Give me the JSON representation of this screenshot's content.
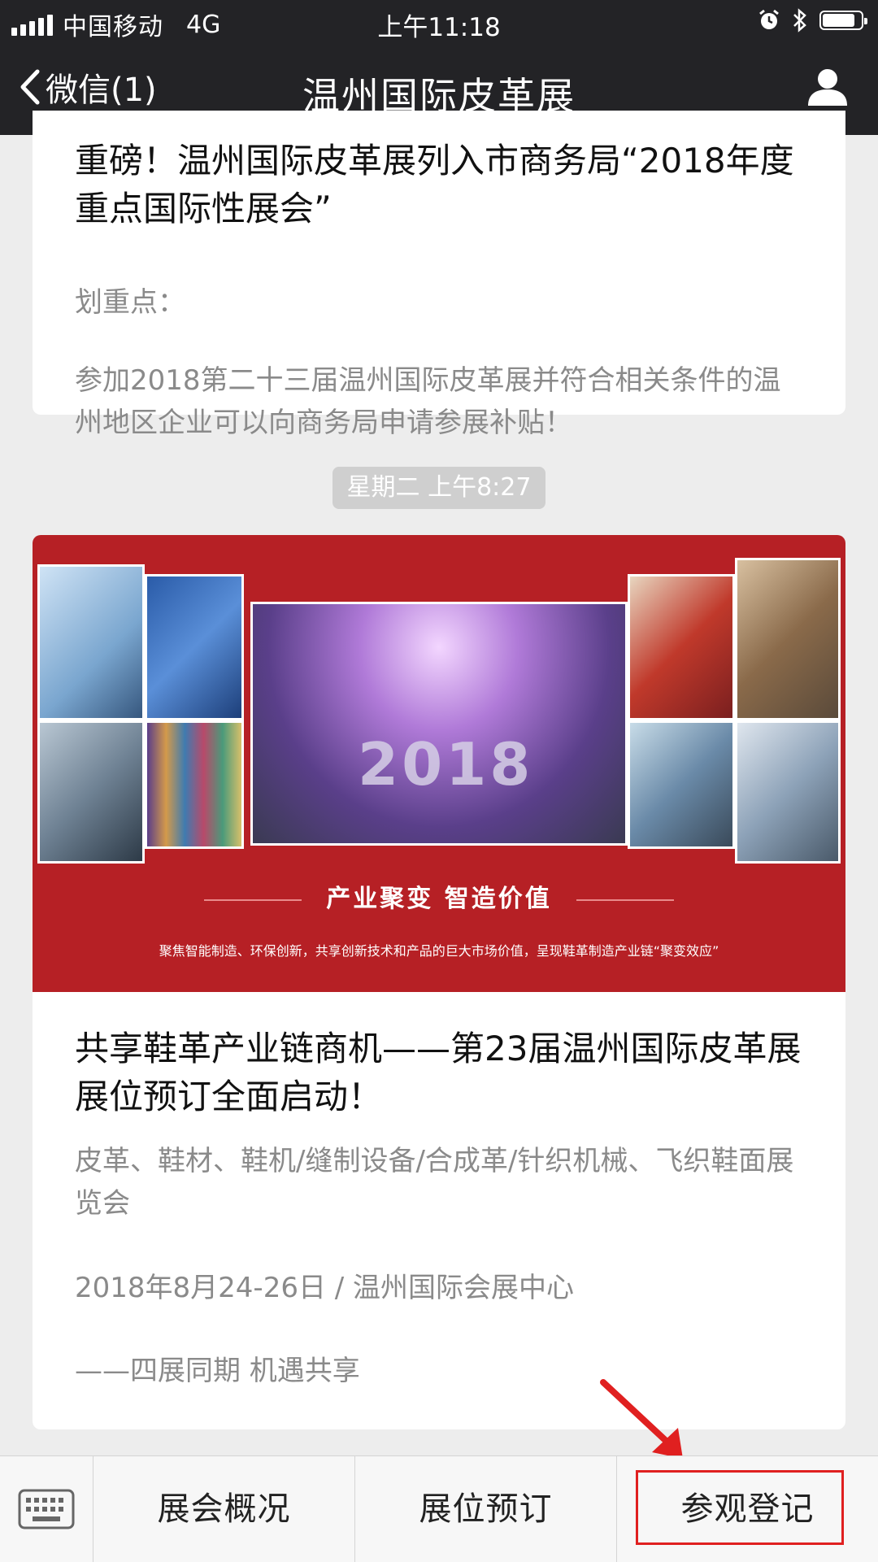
{
  "status_bar": {
    "carrier": "中国移动",
    "network": "4G",
    "time": "上午11:18"
  },
  "nav": {
    "back_label": "微信(1)",
    "title": "温州国际皮革展"
  },
  "messages": [
    {
      "headline": "重磅！温州国际皮革展列入市商务局“2018年度重点国际性展会”",
      "desc_line1": "划重点：",
      "desc": "参加2018第二十三届温州国际皮革展并符合相关条件的温州地区企业可以向商务局申请参展补贴！"
    },
    {
      "timestamp": "星期二 上午8:27",
      "banner": {
        "year": "2018",
        "slogan": "产业聚变  智造价值",
        "subline": "聚焦智能制造、环保创新，共享创新技术和产品的巨大市场价值，呈现鞋革制造产业链“聚变效应”"
      },
      "headline": "共享鞋革产业链商机——第23届温州国际皮革展展位预订全面启动！",
      "desc1": "皮革、鞋材、鞋机/缝制设备/合成革/针织机械、飞织鞋面展览会",
      "desc2": "2018年8月24-26日 / 温州国际会展中心",
      "desc3": "——四展同期  机遇共享"
    }
  ],
  "menu": {
    "items": [
      "展会概况",
      "展位预订",
      "参观登记"
    ]
  },
  "colors": {
    "nav_bg": "#232326",
    "banner_red": "#b62025",
    "highlight_red": "#e02020"
  }
}
